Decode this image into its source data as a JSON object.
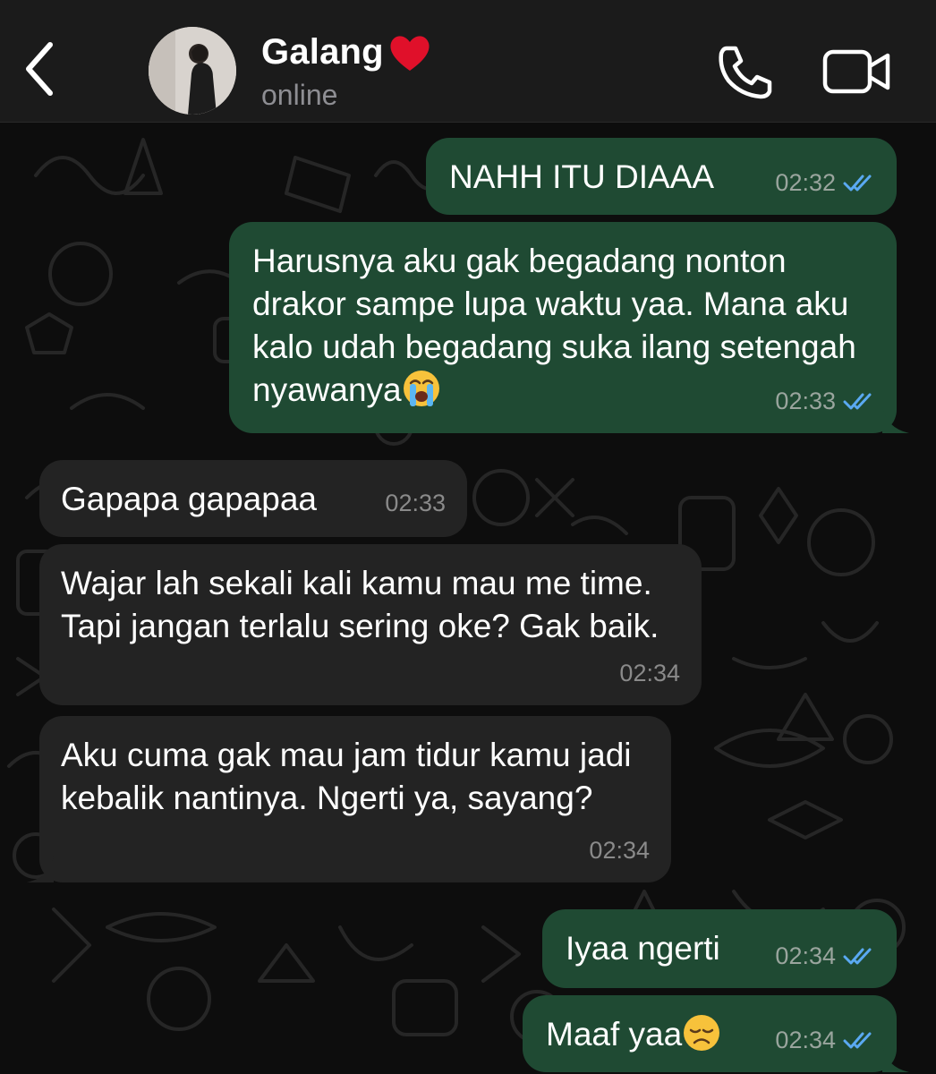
{
  "header": {
    "contact_name": "Galang",
    "status": "online",
    "back_icon": "chevron-left-icon",
    "call_icon": "phone-icon",
    "video_icon": "video-camera-icon",
    "name_emoji": "red-heart-emoji"
  },
  "messages": [
    {
      "direction": "outgoing",
      "text": "NAHH ITU DIAAA",
      "time": "02:32",
      "status": "read"
    },
    {
      "direction": "outgoing",
      "text": "Harusnya aku gak begadang nonton drakor sampe lupa waktu yaa. Mana aku kalo udah begadang suka ilang setengah nyawanya",
      "emoji": "loudly-crying-face",
      "time": "02:33",
      "status": "read"
    },
    {
      "direction": "incoming",
      "text": "Gapapa gapapaa",
      "time": "02:33"
    },
    {
      "direction": "incoming",
      "text": "Wajar lah sekali kali kamu mau me time. Tapi jangan terlalu sering oke? Gak baik.",
      "time": "02:34"
    },
    {
      "direction": "incoming",
      "text": "Aku cuma gak mau jam tidur kamu jadi kebalik nantinya. Ngerti ya, sayang?",
      "time": "02:34"
    },
    {
      "direction": "outgoing",
      "text": "Iyaa ngerti",
      "time": "02:34",
      "status": "read"
    },
    {
      "direction": "outgoing",
      "text": "Maaf yaa",
      "emoji": "disappointed-face",
      "time": "02:34",
      "status": "read"
    }
  ],
  "colors": {
    "header_bg": "#1b1b1b",
    "chat_bg": "#0d0d0d",
    "outgoing_bubble": "#1f4a33",
    "incoming_bubble": "#232323",
    "read_ticks": "#5aa9f2",
    "meta_text": "#9aa59e"
  }
}
